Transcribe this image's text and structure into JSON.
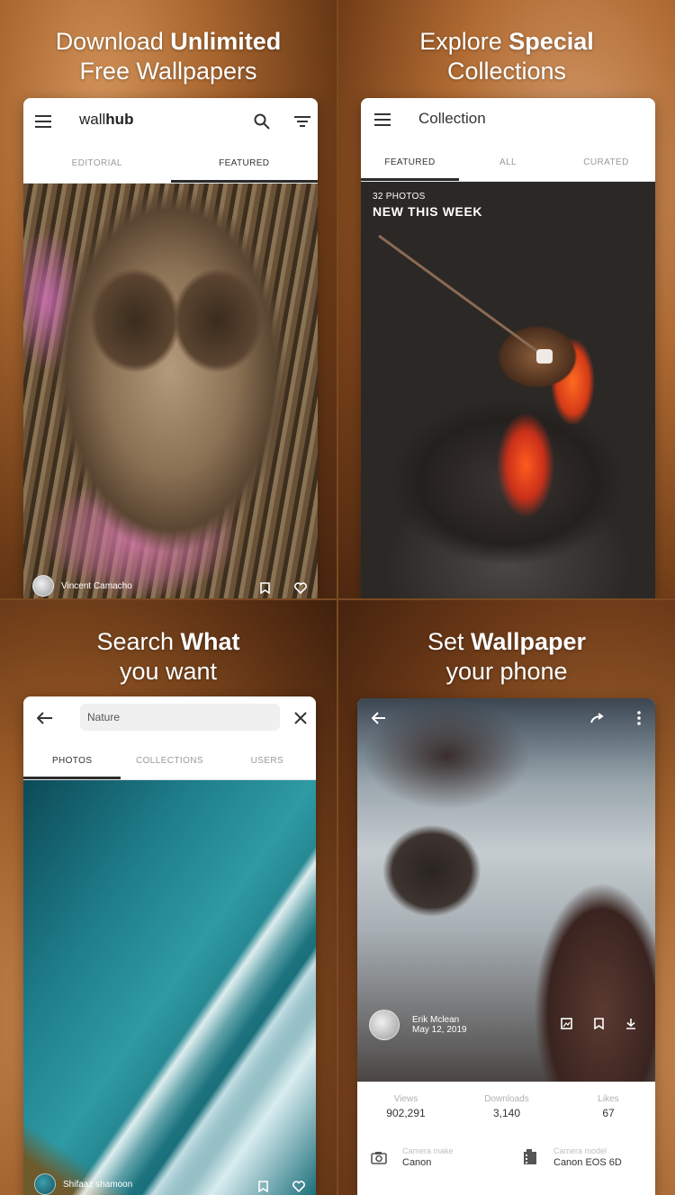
{
  "panel1": {
    "headline_line1_normal": "Download",
    "headline_line1_bold": "Unlimited",
    "headline_line2": "Free Wallpapers",
    "app_title_light": "wall",
    "app_title_bold": "hub",
    "tabs": [
      "EDITORIAL",
      "FEATURED"
    ],
    "photographer": "Vincent Camacho"
  },
  "panel2": {
    "headline_line1_normal": "Explore",
    "headline_line1_bold": "Special",
    "headline_line2": "Collections",
    "app_title": "Collection",
    "tabs": [
      "FEATURED",
      "ALL",
      "CURATED"
    ],
    "collection_count": "32 PHOTOS",
    "collection_name": "NEW THIS WEEK"
  },
  "panel3": {
    "headline_line1_normal": "Search",
    "headline_line1_bold": "What",
    "headline_line2": "you want",
    "search_value": "Nature",
    "tabs": [
      "PHOTOS",
      "COLLECTIONS",
      "USERS"
    ],
    "photographer": "Shifaaz shamoon"
  },
  "panel4": {
    "headline_line1_normal": "Set",
    "headline_line1_bold": "Wallpaper",
    "headline_line2": "your phone",
    "photographer": "Erik Mclean",
    "date": "May 12, 2019",
    "stats": {
      "views_label": "Views",
      "views": "902,291",
      "downloads_label": "Downloads",
      "downloads": "3,140",
      "likes_label": "Likes",
      "likes": "67"
    },
    "camera_make_label": "Camera make",
    "camera_make": "Canon",
    "camera_model_label": "Camera model",
    "camera_model": "Canon EOS 6D"
  },
  "icons": {
    "menu": "menu-icon",
    "search": "search-icon",
    "filter": "filter-icon",
    "back": "arrow-back-icon",
    "close": "close-icon",
    "share": "share-icon",
    "more": "more-vert-icon",
    "bookmark": "bookmark-icon",
    "heart": "heart-icon",
    "set_wallpaper": "wallpaper-icon",
    "download": "download-icon",
    "camera": "camera-icon",
    "film": "film-icon"
  }
}
